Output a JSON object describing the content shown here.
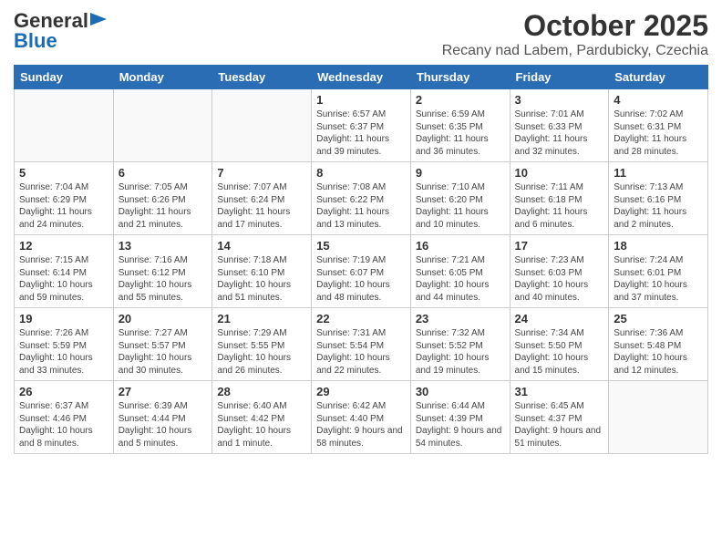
{
  "logo": {
    "general": "General",
    "blue": "Blue"
  },
  "header": {
    "title": "October 2025",
    "subtitle": "Recany nad Labem, Pardubicky, Czechia"
  },
  "days": [
    "Sunday",
    "Monday",
    "Tuesday",
    "Wednesday",
    "Thursday",
    "Friday",
    "Saturday"
  ],
  "weeks": [
    [
      {
        "num": "",
        "info": ""
      },
      {
        "num": "",
        "info": ""
      },
      {
        "num": "",
        "info": ""
      },
      {
        "num": "1",
        "info": "Sunrise: 6:57 AM\nSunset: 6:37 PM\nDaylight: 11 hours and 39 minutes."
      },
      {
        "num": "2",
        "info": "Sunrise: 6:59 AM\nSunset: 6:35 PM\nDaylight: 11 hours and 36 minutes."
      },
      {
        "num": "3",
        "info": "Sunrise: 7:01 AM\nSunset: 6:33 PM\nDaylight: 11 hours and 32 minutes."
      },
      {
        "num": "4",
        "info": "Sunrise: 7:02 AM\nSunset: 6:31 PM\nDaylight: 11 hours and 28 minutes."
      }
    ],
    [
      {
        "num": "5",
        "info": "Sunrise: 7:04 AM\nSunset: 6:29 PM\nDaylight: 11 hours and 24 minutes."
      },
      {
        "num": "6",
        "info": "Sunrise: 7:05 AM\nSunset: 6:26 PM\nDaylight: 11 hours and 21 minutes."
      },
      {
        "num": "7",
        "info": "Sunrise: 7:07 AM\nSunset: 6:24 PM\nDaylight: 11 hours and 17 minutes."
      },
      {
        "num": "8",
        "info": "Sunrise: 7:08 AM\nSunset: 6:22 PM\nDaylight: 11 hours and 13 minutes."
      },
      {
        "num": "9",
        "info": "Sunrise: 7:10 AM\nSunset: 6:20 PM\nDaylight: 11 hours and 10 minutes."
      },
      {
        "num": "10",
        "info": "Sunrise: 7:11 AM\nSunset: 6:18 PM\nDaylight: 11 hours and 6 minutes."
      },
      {
        "num": "11",
        "info": "Sunrise: 7:13 AM\nSunset: 6:16 PM\nDaylight: 11 hours and 2 minutes."
      }
    ],
    [
      {
        "num": "12",
        "info": "Sunrise: 7:15 AM\nSunset: 6:14 PM\nDaylight: 10 hours and 59 minutes."
      },
      {
        "num": "13",
        "info": "Sunrise: 7:16 AM\nSunset: 6:12 PM\nDaylight: 10 hours and 55 minutes."
      },
      {
        "num": "14",
        "info": "Sunrise: 7:18 AM\nSunset: 6:10 PM\nDaylight: 10 hours and 51 minutes."
      },
      {
        "num": "15",
        "info": "Sunrise: 7:19 AM\nSunset: 6:07 PM\nDaylight: 10 hours and 48 minutes."
      },
      {
        "num": "16",
        "info": "Sunrise: 7:21 AM\nSunset: 6:05 PM\nDaylight: 10 hours and 44 minutes."
      },
      {
        "num": "17",
        "info": "Sunrise: 7:23 AM\nSunset: 6:03 PM\nDaylight: 10 hours and 40 minutes."
      },
      {
        "num": "18",
        "info": "Sunrise: 7:24 AM\nSunset: 6:01 PM\nDaylight: 10 hours and 37 minutes."
      }
    ],
    [
      {
        "num": "19",
        "info": "Sunrise: 7:26 AM\nSunset: 5:59 PM\nDaylight: 10 hours and 33 minutes."
      },
      {
        "num": "20",
        "info": "Sunrise: 7:27 AM\nSunset: 5:57 PM\nDaylight: 10 hours and 30 minutes."
      },
      {
        "num": "21",
        "info": "Sunrise: 7:29 AM\nSunset: 5:55 PM\nDaylight: 10 hours and 26 minutes."
      },
      {
        "num": "22",
        "info": "Sunrise: 7:31 AM\nSunset: 5:54 PM\nDaylight: 10 hours and 22 minutes."
      },
      {
        "num": "23",
        "info": "Sunrise: 7:32 AM\nSunset: 5:52 PM\nDaylight: 10 hours and 19 minutes."
      },
      {
        "num": "24",
        "info": "Sunrise: 7:34 AM\nSunset: 5:50 PM\nDaylight: 10 hours and 15 minutes."
      },
      {
        "num": "25",
        "info": "Sunrise: 7:36 AM\nSunset: 5:48 PM\nDaylight: 10 hours and 12 minutes."
      }
    ],
    [
      {
        "num": "26",
        "info": "Sunrise: 6:37 AM\nSunset: 4:46 PM\nDaylight: 10 hours and 8 minutes."
      },
      {
        "num": "27",
        "info": "Sunrise: 6:39 AM\nSunset: 4:44 PM\nDaylight: 10 hours and 5 minutes."
      },
      {
        "num": "28",
        "info": "Sunrise: 6:40 AM\nSunset: 4:42 PM\nDaylight: 10 hours and 1 minute."
      },
      {
        "num": "29",
        "info": "Sunrise: 6:42 AM\nSunset: 4:40 PM\nDaylight: 9 hours and 58 minutes."
      },
      {
        "num": "30",
        "info": "Sunrise: 6:44 AM\nSunset: 4:39 PM\nDaylight: 9 hours and 54 minutes."
      },
      {
        "num": "31",
        "info": "Sunrise: 6:45 AM\nSunset: 4:37 PM\nDaylight: 9 hours and 51 minutes."
      },
      {
        "num": "",
        "info": ""
      }
    ]
  ]
}
